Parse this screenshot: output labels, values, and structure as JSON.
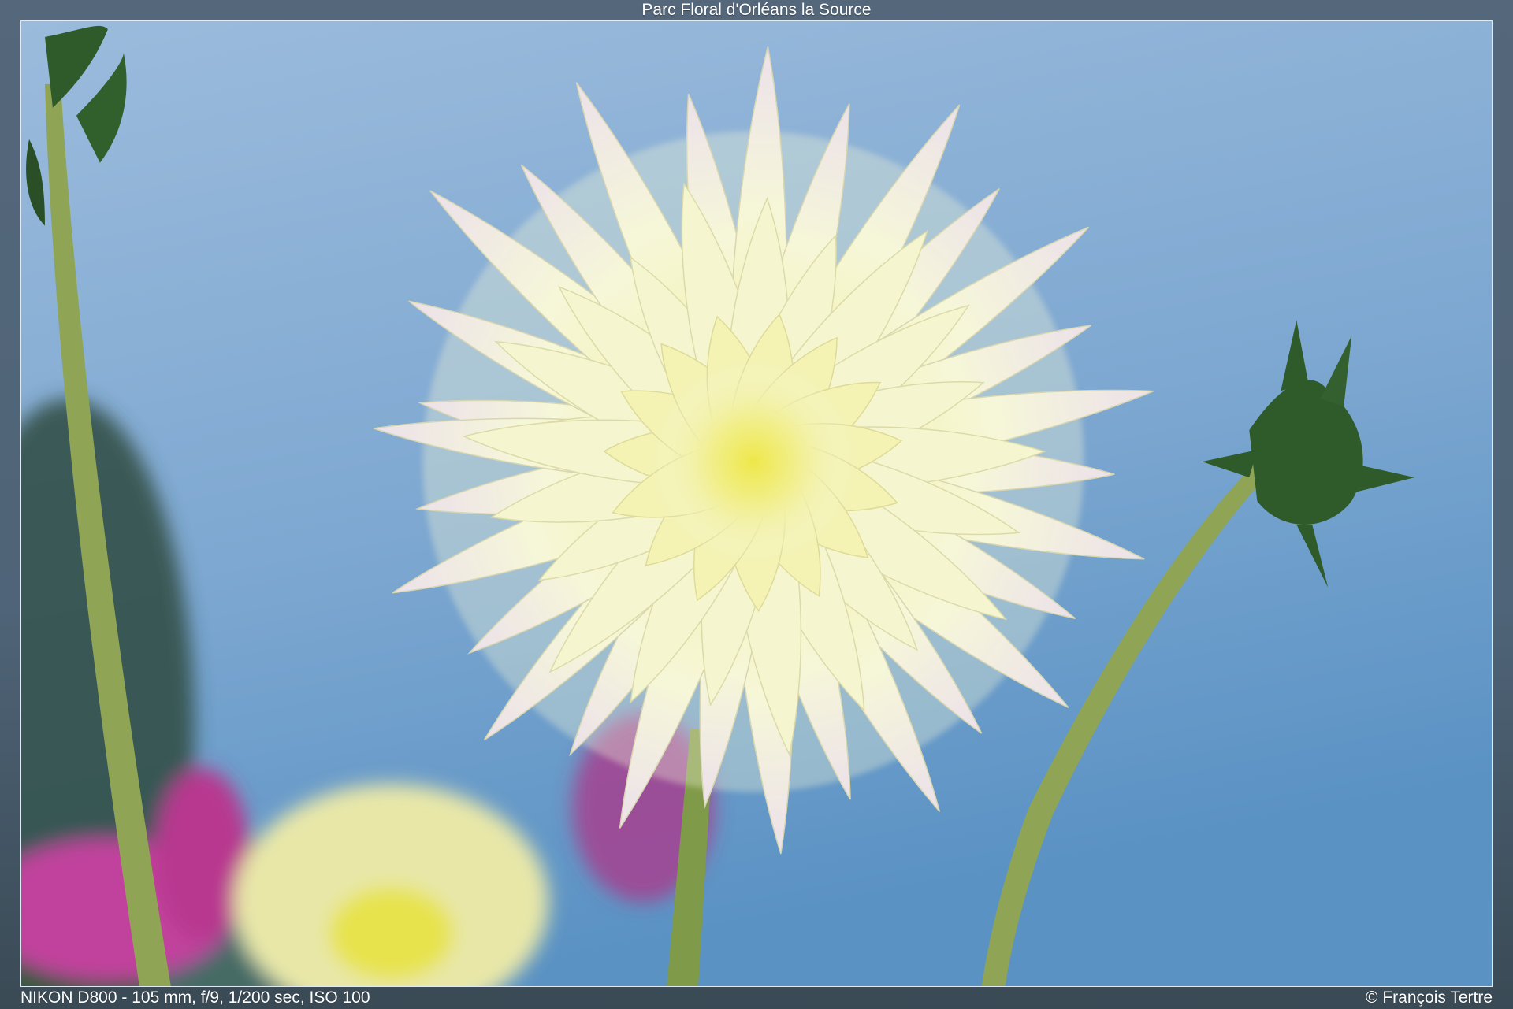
{
  "header": {
    "title": "Parc Floral d'Orléans la Source"
  },
  "footer": {
    "exif": "NIKON D800 - 105 mm, f/9, 1/200 sec, ISO 100",
    "credit": "© François Tertre"
  },
  "colors": {
    "sky_top": "#8fb2d6",
    "sky_bottom": "#5f96c6",
    "petal": "#f3f5cf",
    "petal_tip": "#e7dde6",
    "center": "#f1ee6a",
    "stem": "#8fa455",
    "leaf": "#2f5a2a",
    "magenta": "#c13c9a"
  }
}
